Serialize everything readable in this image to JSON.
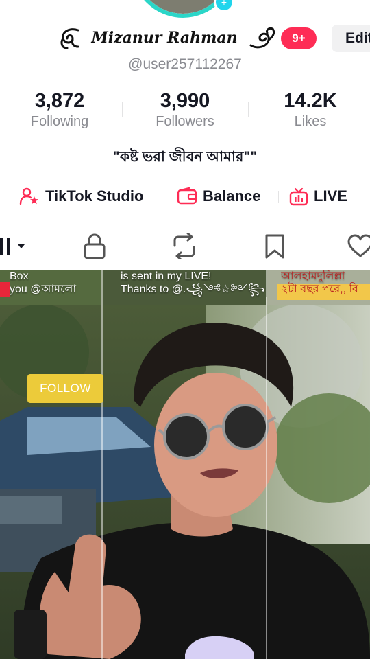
{
  "profile": {
    "display_name": "Mizanur Rahman",
    "username": "@user257112267",
    "notification_badge": "9+",
    "edit_label": "Edit",
    "bio": "\"কষ্ট ভরা জীবন আমার\"\""
  },
  "stats": [
    {
      "value": "3,872",
      "label": "Following"
    },
    {
      "value": "3,990",
      "label": "Followers"
    },
    {
      "value": "14.2K",
      "label": "Likes"
    }
  ],
  "tools": [
    {
      "label": "TikTok Studio",
      "icon": "creator-icon"
    },
    {
      "label": "Balance",
      "icon": "wallet-icon"
    },
    {
      "label": "LIVE",
      "icon": "live-tv-icon"
    }
  ],
  "tabs": [
    {
      "icon": "grid-icon"
    },
    {
      "icon": "lock-icon"
    },
    {
      "icon": "repost-icon"
    },
    {
      "icon": "bookmark-icon"
    },
    {
      "icon": "heart-icon"
    }
  ],
  "thumbnails": [
    {
      "lines": [
        "Box",
        "you @আমলো"
      ]
    },
    {
      "lines": [
        "is sent in my LIVE!",
        "Thanks to @.꧁༺☆༻꧂"
      ]
    },
    {
      "lines": [
        "আলহামদুলিল্লা",
        "২টা বছর পরে,, বি"
      ]
    }
  ],
  "video": {
    "follow_label": "FOLLOW"
  },
  "colors": {
    "accent": "#fe2c55",
    "follow_button": "#eccb3a",
    "text_secondary": "#8a8b91",
    "avatar_ring": "#2bd6c8"
  }
}
